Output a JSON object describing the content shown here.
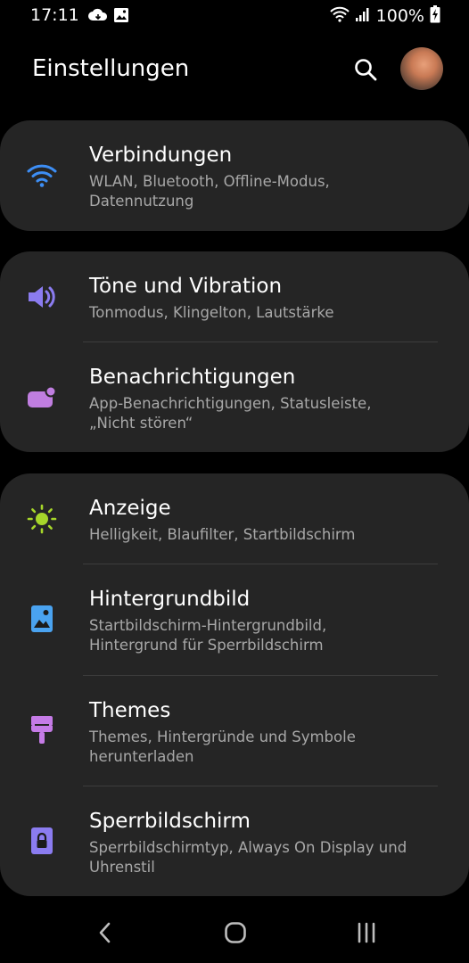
{
  "status_bar": {
    "time": "17:11",
    "battery": "100%"
  },
  "header": {
    "title": "Einstellungen"
  },
  "groups": [
    {
      "items": [
        {
          "title": "Verbindungen",
          "subtitle_line1": "WLAN, Bluetooth, Offline-Modus,",
          "subtitle_line2": "Datennutzung",
          "icon": "wifi-icon",
          "icon_color": "#3d8ef5"
        }
      ]
    },
    {
      "items": [
        {
          "title": "Töne und Vibration",
          "subtitle_line1": "Tonmodus, Klingelton, Lautstärke",
          "icon": "volume-icon",
          "icon_color": "#8b7cf0"
        },
        {
          "title": "Benachrichtigungen",
          "subtitle_line1": "App-Benachrichtigungen, Statusleiste,",
          "subtitle_line2": "„Nicht stören“",
          "icon": "notifications-icon",
          "icon_color": "#c07ee0"
        }
      ]
    },
    {
      "items": [
        {
          "title": "Anzeige",
          "subtitle_line1": "Helligkeit, Blaufilter, Startbildschirm",
          "icon": "brightness-icon",
          "icon_color": "#a6d62a"
        },
        {
          "title": "Hintergrundbild",
          "subtitle_line1": "Startbildschirm-Hintergrundbild,",
          "subtitle_line2": "Hintergrund für Sperrbildschirm",
          "icon": "wallpaper-icon",
          "icon_color": "#4aa3f0"
        },
        {
          "title": "Themes",
          "subtitle_line1": "Themes, Hintergründe und Symbole",
          "subtitle_line2": "herunterladen",
          "icon": "paintbrush-icon",
          "icon_color": "#c57be6"
        },
        {
          "title": "Sperrbildschirm",
          "subtitle_line1": "Sperrbildschirmtyp, Always On Display und",
          "subtitle_line2": "Uhrenstil",
          "icon": "lock-icon",
          "icon_color": "#8b7cf0"
        }
      ]
    }
  ],
  "nav": {
    "back": "back-icon",
    "home": "home-icon",
    "recents": "recents-icon"
  }
}
